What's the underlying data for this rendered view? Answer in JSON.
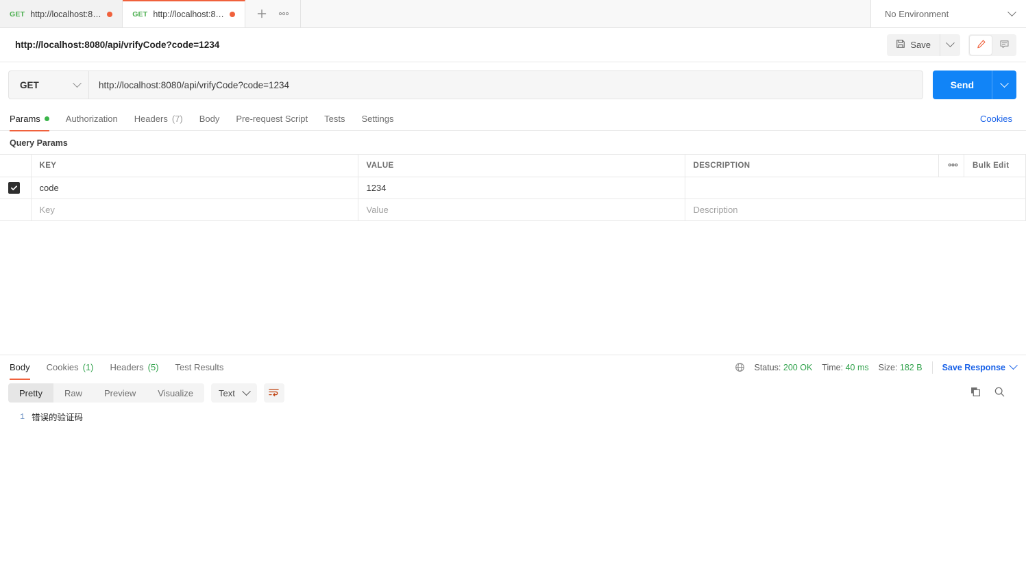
{
  "tabbar": {
    "tabs": [
      {
        "method": "GET",
        "label": "http://localhost:80...",
        "unsaved": true,
        "active": false
      },
      {
        "method": "GET",
        "label": "http://localhost:80...",
        "unsaved": true,
        "active": true
      }
    ],
    "new_tab_label": "+",
    "more_label": "○○○",
    "environment": "No Environment"
  },
  "namebar": {
    "request_name": "http://localhost:8080/api/vrifyCode?code=1234",
    "save_label": "Save"
  },
  "urlbar": {
    "method": "GET",
    "url": "http://localhost:8080/api/vrifyCode?code=1234",
    "send_label": "Send"
  },
  "request_tabs": {
    "items": [
      {
        "label": "Params",
        "count": "",
        "dot": true,
        "active": true
      },
      {
        "label": "Authorization",
        "count": "",
        "dot": false,
        "active": false
      },
      {
        "label": "Headers",
        "count": "(7)",
        "dot": false,
        "active": false
      },
      {
        "label": "Body",
        "count": "",
        "dot": false,
        "active": false
      },
      {
        "label": "Pre-request Script",
        "count": "",
        "dot": false,
        "active": false
      },
      {
        "label": "Tests",
        "count": "",
        "dot": false,
        "active": false
      },
      {
        "label": "Settings",
        "count": "",
        "dot": false,
        "active": false
      }
    ],
    "cookies_link": "Cookies"
  },
  "query_params": {
    "section_title": "Query Params",
    "headers": {
      "key": "KEY",
      "value": "VALUE",
      "description": "DESCRIPTION",
      "more": "○○○",
      "bulk_edit": "Bulk Edit"
    },
    "rows": [
      {
        "checked": true,
        "key": "code",
        "value": "1234",
        "description": "",
        "placeholder": false
      },
      {
        "checked": false,
        "key": "Key",
        "value": "Value",
        "description": "Description",
        "placeholder": true
      }
    ]
  },
  "response": {
    "tabs": [
      {
        "label": "Body",
        "count": "",
        "active": true
      },
      {
        "label": "Cookies",
        "count": "(1)",
        "active": false
      },
      {
        "label": "Headers",
        "count": "(5)",
        "active": false
      },
      {
        "label": "Test Results",
        "count": "",
        "active": false
      }
    ],
    "status_label": "Status:",
    "status_value": "200 OK",
    "time_label": "Time:",
    "time_value": "40 ms",
    "size_label": "Size:",
    "size_value": "182 B",
    "save_response": "Save Response",
    "view_modes": [
      {
        "label": "Pretty",
        "active": true
      },
      {
        "label": "Raw",
        "active": false
      },
      {
        "label": "Preview",
        "active": false
      },
      {
        "label": "Visualize",
        "active": false
      }
    ],
    "format": "Text",
    "body_lines": [
      {
        "num": "1",
        "text": "错误的验证码"
      }
    ]
  },
  "colors": {
    "accent_orange": "#f0613c",
    "send_blue": "#1184f7",
    "link_blue": "#1a62e8",
    "success_green": "#31a24c",
    "method_green": "#4caf50"
  }
}
